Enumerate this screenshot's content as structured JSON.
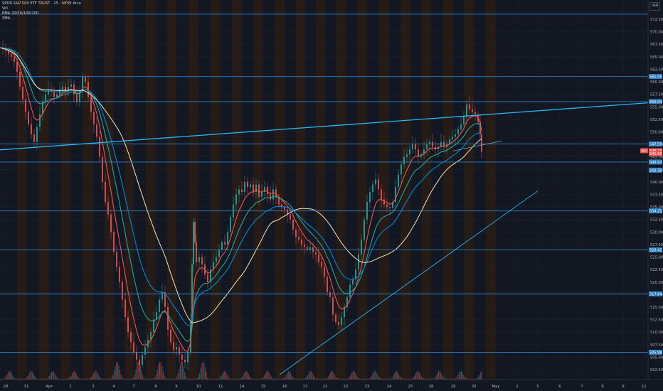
{
  "symbol": {
    "title": "SPDR S&P 500 ETF TRUST · 15 · NYSE Arca",
    "indicator_lines": [
      "Vol",
      "EMA 20/50/100/200",
      "SMA"
    ]
  },
  "currency_button": "USD",
  "colors": {
    "background": "#131722",
    "session_band": "#2a1c15",
    "grid": "#1e2230",
    "level_line": "#2f7fc0",
    "trend_line": "#29b6f6",
    "candle_down": "#ef5350",
    "candle_up": "#26a69a",
    "ema_fast": "#ef5350",
    "ema_mid": "#26a69a",
    "ema_slow": "#0288d1",
    "sma": "#f5e6b8"
  },
  "chart_data": {
    "type": "line",
    "title": "SPDR S&P 500 ETF TRUST · 15 · NYSE Arca",
    "price_axis": {
      "ticks": [
        572.5,
        570.0,
        567.5,
        565.0,
        562.5,
        560.0,
        557.5,
        555.0,
        552.5,
        550.0,
        547.5,
        545.0,
        542.5,
        540.0,
        537.5,
        535.0,
        532.5,
        530.0,
        527.5,
        525.0,
        522.5,
        520.0,
        517.5,
        515.0,
        512.5,
        510.0,
        507.5,
        505.0,
        502.5
      ],
      "ylim": [
        501.0,
        574.0
      ]
    },
    "time_axis": {
      "labels": [
        "28",
        "31",
        "Apr",
        "2",
        "3",
        "4",
        "7",
        "8",
        "9",
        "10",
        "11",
        "14",
        "15",
        "16",
        "17",
        "21",
        "22",
        "23",
        "24",
        "25",
        "28",
        "29",
        "30",
        "May",
        "2",
        "5",
        "6",
        "7",
        "8",
        "9",
        "12"
      ],
      "x": [
        8,
        37,
        69,
        99,
        131,
        160,
        188,
        219,
        248,
        279,
        310,
        340,
        370,
        400,
        429,
        457,
        486,
        516,
        547,
        577,
        606,
        637,
        666,
        697,
        727,
        756,
        787,
        818,
        847,
        876,
        905
      ]
    },
    "horizontal_levels": [
      {
        "price": 573.5,
        "label": ""
      },
      {
        "price": 561.05,
        "label": "561.05"
      },
      {
        "price": 556.04,
        "label": "556.04"
      },
      {
        "price": 547.59,
        "label": "547.59"
      },
      {
        "price": 543.97,
        "label": "543.97"
      },
      {
        "price": 534.21,
        "label": "534.21"
      },
      {
        "price": 526.42,
        "label": "526.42"
      },
      {
        "price": 517.64,
        "label": "517.64"
      },
      {
        "price": 505.98,
        "label": "505.98"
      }
    ],
    "price_badges": [
      {
        "price": 546.23,
        "label": "546.23",
        "tag": "SPY",
        "color": "#ef5350"
      },
      {
        "price": 545.63,
        "label": "545.63",
        "tag": "",
        "color": "#ef5350"
      },
      {
        "price": 542.35,
        "label": "542.35",
        "tag": "",
        "color": "#2f7fc0"
      }
    ],
    "trendlines": [
      {
        "from": [
          "Mar 28",
          546.4
        ],
        "to": [
          "May 12",
          555.8
        ]
      },
      {
        "from": [
          "Apr 15",
          501.5
        ],
        "to": [
          "May 5",
          538.2
        ]
      },
      {
        "from": [
          "Apr 29",
          546.2
        ],
        "to": [
          "May 1",
          548.2
        ]
      }
    ],
    "close_path": [
      [
        0,
        566.8
      ],
      [
        4,
        566.5
      ],
      [
        8,
        566.2
      ],
      [
        12,
        565.5
      ],
      [
        16,
        565.0
      ],
      [
        20,
        564.0
      ],
      [
        24,
        562.0
      ],
      [
        28,
        559.0
      ],
      [
        32,
        556.5
      ],
      [
        36,
        554.0
      ],
      [
        40,
        551.5
      ],
      [
        44,
        549.5
      ],
      [
        48,
        548.0
      ],
      [
        52,
        551.0
      ],
      [
        56,
        553.5
      ],
      [
        60,
        556.0
      ],
      [
        64,
        557.5
      ],
      [
        68,
        558.5
      ],
      [
        72,
        558.0
      ],
      [
        76,
        557.0
      ],
      [
        80,
        557.5
      ],
      [
        84,
        558.5
      ],
      [
        88,
        559.0
      ],
      [
        92,
        558.0
      ],
      [
        96,
        559.0
      ],
      [
        100,
        559.5
      ],
      [
        104,
        557.5
      ],
      [
        108,
        556.0
      ],
      [
        112,
        558.0
      ],
      [
        116,
        561.0
      ],
      [
        120,
        560.0
      ],
      [
        124,
        557.0
      ],
      [
        128,
        554.0
      ],
      [
        132,
        551.5
      ],
      [
        136,
        549.0
      ],
      [
        140,
        545.0
      ],
      [
        144,
        540.0
      ],
      [
        148,
        536.0
      ],
      [
        152,
        533.5
      ],
      [
        156,
        530.0
      ],
      [
        160,
        526.0
      ],
      [
        164,
        523.0
      ],
      [
        168,
        520.0
      ],
      [
        172,
        516.5
      ],
      [
        176,
        513.0
      ],
      [
        180,
        510.0
      ],
      [
        184,
        508.0
      ],
      [
        188,
        506.0
      ],
      [
        192,
        504.5
      ],
      [
        196,
        503.5
      ],
      [
        200,
        505.5
      ],
      [
        204,
        507.0
      ],
      [
        208,
        508.5
      ],
      [
        212,
        510.0
      ],
      [
        216,
        512.5
      ],
      [
        220,
        514.0
      ],
      [
        224,
        516.5
      ],
      [
        228,
        518.0
      ],
      [
        232,
        515.0
      ],
      [
        236,
        510.5
      ],
      [
        240,
        508.0
      ],
      [
        244,
        506.5
      ],
      [
        248,
        507.0
      ],
      [
        252,
        505.5
      ],
      [
        256,
        504.5
      ],
      [
        260,
        504.0
      ],
      [
        264,
        506.0
      ],
      [
        268,
        512.0
      ],
      [
        270,
        523.5
      ],
      [
        272,
        532.0
      ],
      [
        274,
        528.0
      ],
      [
        276,
        524.0
      ],
      [
        280,
        525.0
      ],
      [
        284,
        523.5
      ],
      [
        288,
        521.5
      ],
      [
        292,
        520.0
      ],
      [
        296,
        522.5
      ],
      [
        300,
        524.0
      ],
      [
        304,
        525.0
      ],
      [
        308,
        526.5
      ],
      [
        312,
        528.0
      ],
      [
        316,
        527.5
      ],
      [
        320,
        530.0
      ],
      [
        324,
        533.0
      ],
      [
        328,
        535.5
      ],
      [
        332,
        537.5
      ],
      [
        336,
        538.5
      ],
      [
        340,
        538.0
      ],
      [
        344,
        540.0
      ],
      [
        348,
        539.0
      ],
      [
        352,
        539.5
      ],
      [
        356,
        538.0
      ],
      [
        360,
        539.5
      ],
      [
        364,
        537.0
      ],
      [
        368,
        538.0
      ],
      [
        372,
        539.0
      ],
      [
        376,
        537.5
      ],
      [
        380,
        536.5
      ],
      [
        384,
        538.5
      ],
      [
        388,
        537.0
      ],
      [
        392,
        535.5
      ],
      [
        396,
        535.0
      ],
      [
        400,
        534.5
      ],
      [
        404,
        533.5
      ],
      [
        408,
        532.5
      ],
      [
        412,
        530.5
      ],
      [
        416,
        529.0
      ],
      [
        420,
        528.5
      ],
      [
        424,
        527.5
      ],
      [
        428,
        527.0
      ],
      [
        432,
        526.5
      ],
      [
        436,
        527.0
      ],
      [
        440,
        526.0
      ],
      [
        444,
        525.5
      ],
      [
        448,
        524.0
      ],
      [
        452,
        523.0
      ],
      [
        456,
        521.0
      ],
      [
        460,
        518.0
      ],
      [
        464,
        517.0
      ],
      [
        468,
        513.5
      ],
      [
        472,
        512.0
      ],
      [
        476,
        511.5
      ],
      [
        480,
        513.0
      ],
      [
        484,
        515.0
      ],
      [
        488,
        517.0
      ],
      [
        492,
        519.5
      ],
      [
        496,
        520.5
      ],
      [
        500,
        522.5
      ],
      [
        504,
        525.5
      ],
      [
        508,
        528.5
      ],
      [
        512,
        532.5
      ],
      [
        516,
        536.0
      ],
      [
        520,
        538.0
      ],
      [
        524,
        539.5
      ],
      [
        528,
        540.5
      ],
      [
        532,
        538.5
      ],
      [
        536,
        536.5
      ],
      [
        540,
        535.5
      ],
      [
        544,
        535.0
      ],
      [
        548,
        534.8
      ],
      [
        552,
        536.0
      ],
      [
        556,
        539.0
      ],
      [
        560,
        541.5
      ],
      [
        564,
        543.5
      ],
      [
        568,
        545.0
      ],
      [
        572,
        545.5
      ],
      [
        576,
        546.5
      ],
      [
        580,
        547.5
      ],
      [
        584,
        546.5
      ],
      [
        588,
        545.0
      ],
      [
        592,
        545.5
      ],
      [
        596,
        546.5
      ],
      [
        600,
        547.5
      ],
      [
        604,
        548.0
      ],
      [
        608,
        547.0
      ],
      [
        612,
        546.5
      ],
      [
        616,
        547.0
      ],
      [
        620,
        548.0
      ],
      [
        624,
        547.0
      ],
      [
        628,
        547.5
      ],
      [
        632,
        548.5
      ],
      [
        636,
        549.0
      ],
      [
        640,
        549.5
      ],
      [
        644,
        550.5
      ],
      [
        648,
        551.5
      ],
      [
        652,
        553.0
      ],
      [
        656,
        555.5
      ],
      [
        660,
        554.5
      ],
      [
        664,
        554.0
      ],
      [
        668,
        553.5
      ],
      [
        672,
        552.0
      ],
      [
        675,
        549.5
      ],
      [
        677,
        546.0
      ]
    ],
    "moving_averages": [
      "EMA 20",
      "EMA 50",
      "EMA 100",
      "SMA"
    ],
    "grid": true,
    "volume_pane": true
  }
}
